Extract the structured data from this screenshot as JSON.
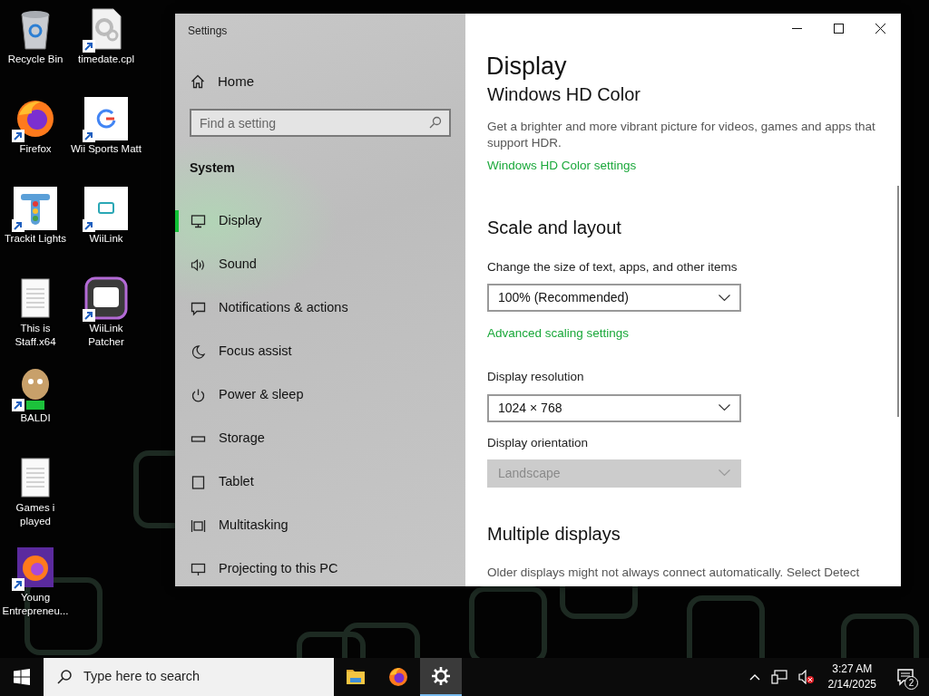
{
  "desktop_icons": [
    {
      "label": "Recycle Bin",
      "shortcut": false
    },
    {
      "label": "Firefox",
      "shortcut": true
    },
    {
      "label": "Trackit Lights",
      "shortcut": true
    },
    {
      "label": "This is Staff.x64",
      "shortcut": false
    },
    {
      "label": "BALDI",
      "shortcut": true
    },
    {
      "label": "Games i played",
      "shortcut": false
    },
    {
      "label": "Young Entrepreneu...",
      "shortcut": true
    },
    {
      "label": "timedate.cpl",
      "shortcut": true
    },
    {
      "label": "Wii Sports Matt",
      "shortcut": true
    },
    {
      "label": "WiiLink",
      "shortcut": true
    },
    {
      "label": "WiiLink Patcher",
      "shortcut": true
    }
  ],
  "window": {
    "title": "Settings"
  },
  "sidebar": {
    "home": "Home",
    "search": {
      "placeholder": "Find a setting"
    },
    "section": "System",
    "items": [
      {
        "label": "Display",
        "selected": true
      },
      {
        "label": "Sound",
        "selected": false
      },
      {
        "label": "Notifications & actions",
        "selected": false
      },
      {
        "label": "Focus assist",
        "selected": false
      },
      {
        "label": "Power & sleep",
        "selected": false
      },
      {
        "label": "Storage",
        "selected": false
      },
      {
        "label": "Tablet",
        "selected": false
      },
      {
        "label": "Multitasking",
        "selected": false
      },
      {
        "label": "Projecting to this PC",
        "selected": false
      }
    ]
  },
  "page": {
    "title": "Display",
    "sections": [
      {
        "heading": "Windows HD Color",
        "description": "Get a brighter and more vibrant picture for videos, games and apps that support HDR.",
        "link": "Windows HD Color settings"
      },
      {
        "heading": "Scale and layout",
        "fields": [
          {
            "label": "Change the size of text, apps, and other items",
            "value": "100% (Recommended)",
            "disabled": false,
            "link": "Advanced scaling settings"
          },
          {
            "label": "Display resolution",
            "value": "1024 × 768",
            "disabled": false
          },
          {
            "label": "Display orientation",
            "value": "Landscape",
            "disabled": true
          }
        ]
      },
      {
        "heading": "Multiple displays",
        "description": "Older displays might not always connect automatically. Select Detect"
      }
    ]
  },
  "taskbar": {
    "search_placeholder": "Type here to search",
    "apps": [
      {
        "active": false
      },
      {
        "active": false
      },
      {
        "active": true
      }
    ],
    "time": "3:27 AM",
    "date": "2/14/2025",
    "notifications": "2"
  }
}
